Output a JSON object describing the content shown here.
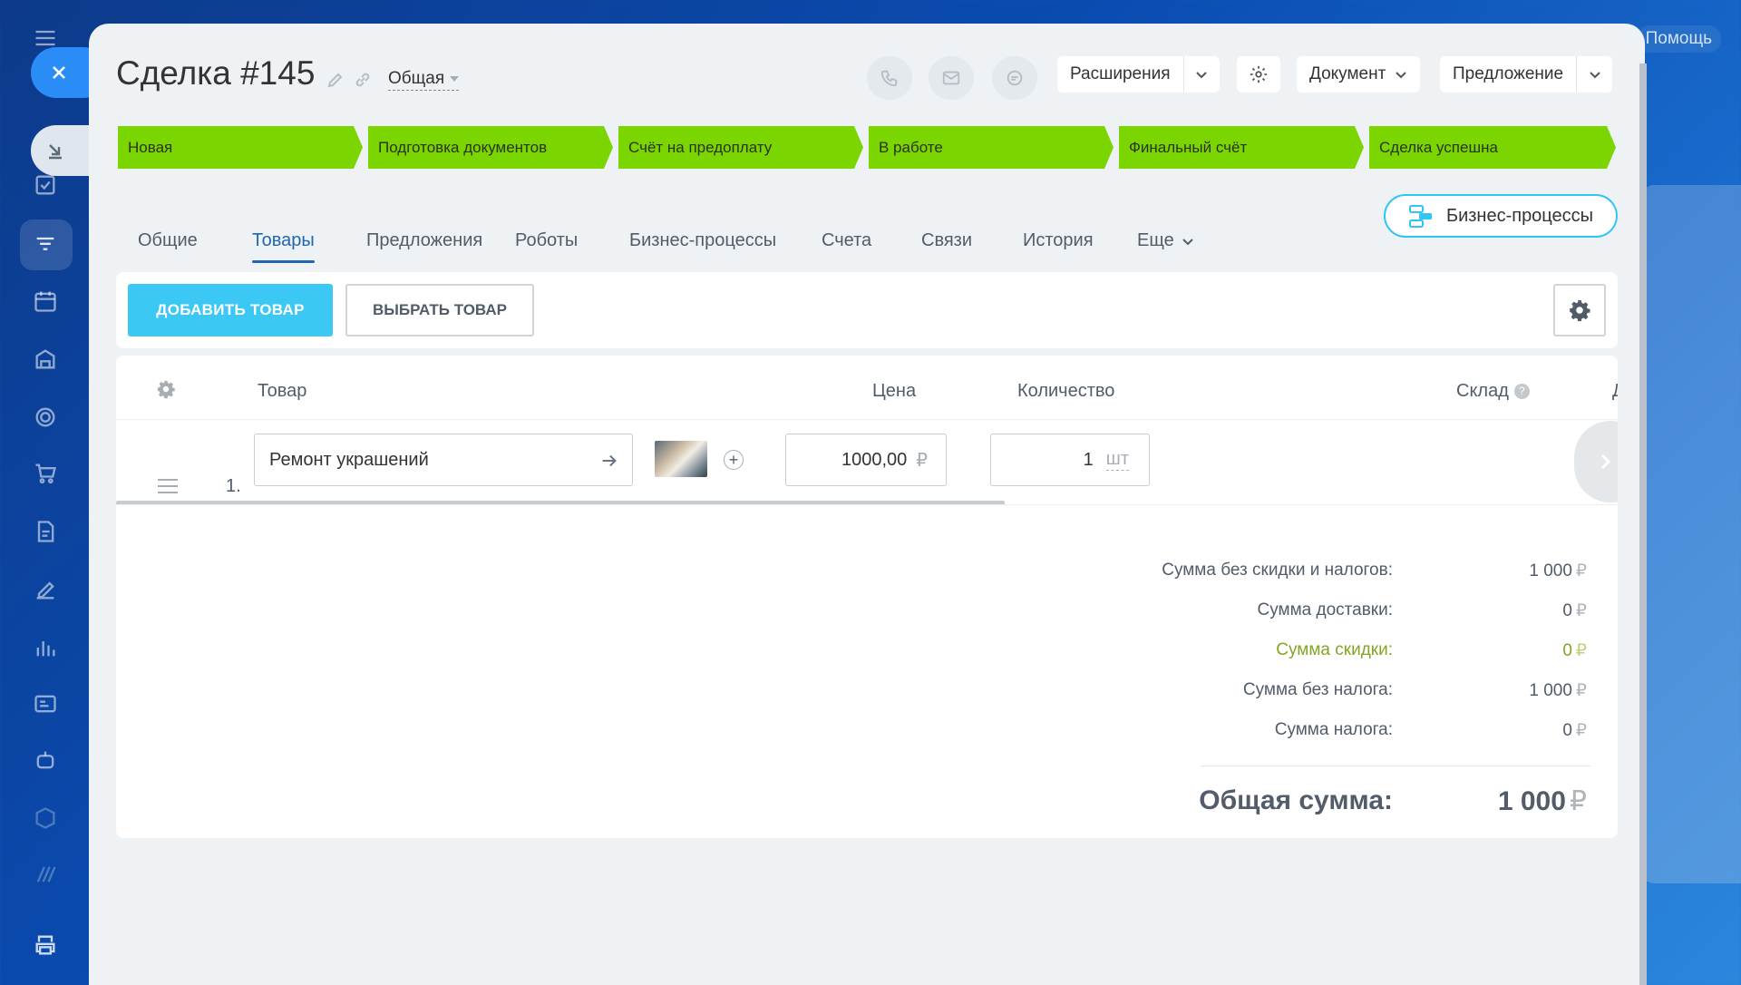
{
  "top": {
    "help_label": "Помощь"
  },
  "deal": {
    "title": "Сделка #145",
    "category": "Общая"
  },
  "header_buttons": {
    "extensions": "Расширения",
    "document": "Документ",
    "proposal": "Предложение"
  },
  "stages": [
    {
      "label": "Новая"
    },
    {
      "label": "Подготовка документов"
    },
    {
      "label": "Счёт на предоплату"
    },
    {
      "label": "В работе"
    },
    {
      "label": "Финальный счёт"
    },
    {
      "label": "Сделка успешна"
    }
  ],
  "stage_color": "#7bd500",
  "tabs": [
    {
      "label": "Общие"
    },
    {
      "label": "Товары"
    },
    {
      "label": "Предложения"
    },
    {
      "label": "Роботы"
    },
    {
      "label": "Бизнес-процессы"
    },
    {
      "label": "Счета"
    },
    {
      "label": "Связи"
    },
    {
      "label": "История"
    },
    {
      "label": "Еще"
    }
  ],
  "active_tab": "Товары",
  "bp_button": "Бизнес-процессы",
  "toolbar": {
    "add_label": "ДОБАВИТЬ ТОВАР",
    "select_label": "ВЫБРАТЬ ТОВАР"
  },
  "table": {
    "columns": {
      "product": "Товар",
      "price": "Цена",
      "quantity": "Количество",
      "warehouse": "Склад",
      "cut": "Д"
    },
    "rows": [
      {
        "num": "1.",
        "name": "Ремонт украшений",
        "price": "1000,00",
        "currency": "₽",
        "qty": "1",
        "unit": "шт"
      }
    ]
  },
  "totals": [
    {
      "label": "Сумма без скидки и налогов:",
      "value": "1 000",
      "currency": "₽"
    },
    {
      "label": "Сумма доставки:",
      "value": "0",
      "currency": "₽"
    },
    {
      "label": "Сумма скидки:",
      "value": "0",
      "currency": "₽"
    },
    {
      "label": "Сумма без налога:",
      "value": "1 000",
      "currency": "₽"
    },
    {
      "label": "Сумма налога:",
      "value": "0",
      "currency": "₽"
    }
  ],
  "grand_total": {
    "label": "Общая сумма:",
    "value": "1 000",
    "currency": "₽"
  },
  "colors": {
    "accent": "#3bc8f5",
    "link": "#2066b0",
    "discount": "#80a626"
  }
}
